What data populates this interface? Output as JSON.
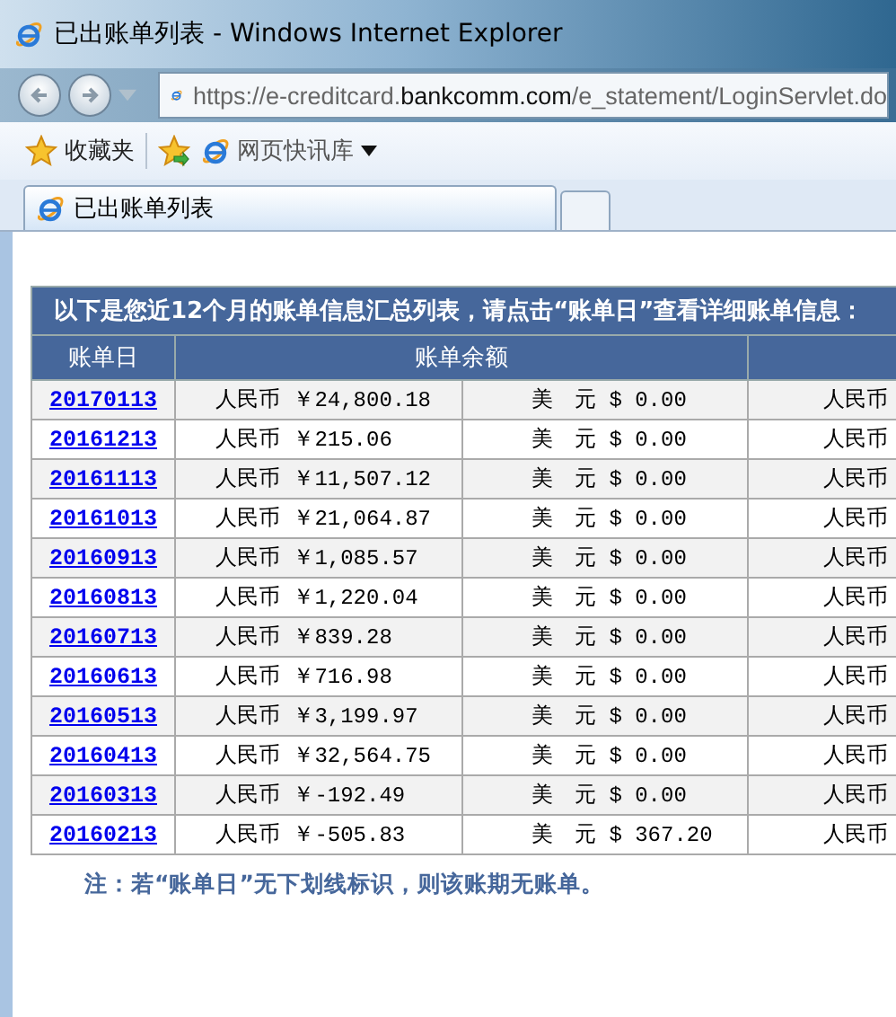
{
  "window": {
    "title": "已出账单列表 - Windows Internet Explorer"
  },
  "address_bar": {
    "url": [
      {
        "text": "https://e-creditcard.",
        "emphasized": false
      },
      {
        "text": "bankcomm.com",
        "emphasized": true
      },
      {
        "text": "/e_statement/LoginServlet.do",
        "emphasized": false
      }
    ]
  },
  "favorites_bar": {
    "favorites": "收藏夹",
    "quick_link": "网页快讯库"
  },
  "tabs": [
    {
      "label": "已出账单列表",
      "selected": true
    }
  ],
  "statement": {
    "title": "以下是您近12个月的账单信息汇总列表，请点击“账单日”查看详细账单信息：",
    "columns": [
      "账单日",
      "账单余额"
    ],
    "rows": [
      {
        "date": "20170113",
        "cny": "人民币 ￥24,800.18",
        "usd": "美　元 $ 0.00",
        "column_4": "人民币"
      },
      {
        "date": "20161213",
        "cny": "人民币 ￥215.06",
        "usd": "美　元 $ 0.00",
        "column_4": "人民币"
      },
      {
        "date": "20161113",
        "cny": "人民币 ￥11,507.12",
        "usd": "美　元 $ 0.00",
        "column_4": "人民币"
      },
      {
        "date": "20161013",
        "cny": "人民币 ￥21,064.87",
        "usd": "美　元 $ 0.00",
        "column_4": "人民币"
      },
      {
        "date": "20160913",
        "cny": "人民币 ￥1,085.57",
        "usd": "美　元 $ 0.00",
        "column_4": "人民币"
      },
      {
        "date": "20160813",
        "cny": "人民币 ￥1,220.04",
        "usd": "美　元 $ 0.00",
        "column_4": "人民币"
      },
      {
        "date": "20160713",
        "cny": "人民币 ￥839.28",
        "usd": "美　元 $ 0.00",
        "column_4": "人民币"
      },
      {
        "date": "20160613",
        "cny": "人民币 ￥716.98",
        "usd": "美　元 $ 0.00",
        "column_4": "人民币"
      },
      {
        "date": "20160513",
        "cny": "人民币 ￥3,199.97",
        "usd": "美　元 $ 0.00",
        "column_4": "人民币"
      },
      {
        "date": "20160413",
        "cny": "人民币 ￥32,564.75",
        "usd": "美　元 $ 0.00",
        "column_4": "人民币"
      },
      {
        "date": "20160313",
        "cny": "人民币 ￥-192.49",
        "usd": "美　元 $ 0.00",
        "column_4": "人民币"
      },
      {
        "date": "20160213",
        "cny": "人民币 ￥-505.83",
        "usd": "美　元 $ 367.20",
        "column_4": "人民币"
      }
    ],
    "note": "注：若“账单日”无下划线标识，则该账期无账单。"
  }
}
